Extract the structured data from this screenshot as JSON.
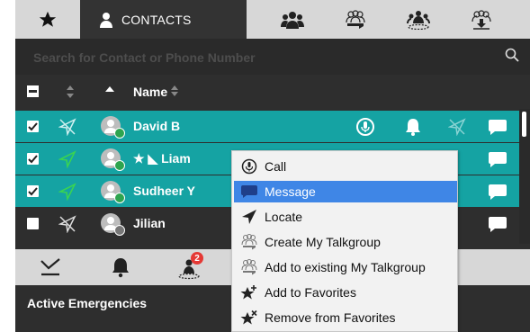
{
  "tabs": {
    "favorites_icon": "star-icon",
    "contacts_label": "CONTACTS",
    "group_icons": [
      "group-icon",
      "talkgroup-icon",
      "nearby-group-icon",
      "download-group-icon"
    ]
  },
  "search": {
    "placeholder": "Search for Contact or Phone Number"
  },
  "list_header": {
    "name_label": "Name"
  },
  "contacts": [
    {
      "name": "David B",
      "selected": true,
      "checked": true,
      "status": "online"
    },
    {
      "name": "★ ◣ Liam",
      "selected": true,
      "checked": true,
      "status": "online"
    },
    {
      "name": "Sudheer Y",
      "selected": true,
      "checked": true,
      "status": "online"
    },
    {
      "name": "Jilian",
      "selected": false,
      "checked": false,
      "status": "offline"
    }
  ],
  "bottom": {
    "emergency_badge": "2",
    "active_emergencies_title": "Active Emergencies"
  },
  "context_menu": {
    "items": [
      {
        "label": "Call",
        "icon": "call-icon",
        "highlighted": false
      },
      {
        "label": "Message",
        "icon": "message-icon",
        "highlighted": true
      },
      {
        "label": "Locate",
        "icon": "locate-icon",
        "highlighted": false
      },
      {
        "label": "Create My Talkgroup",
        "icon": "create-talkgroup-icon",
        "highlighted": false
      },
      {
        "label": "Add to existing My Talkgroup",
        "icon": "add-talkgroup-icon",
        "highlighted": false
      },
      {
        "label": "Add to Favorites",
        "icon": "add-favorite-icon",
        "highlighted": false
      },
      {
        "label": "Remove from Favorites",
        "icon": "remove-favorite-icon",
        "highlighted": false
      }
    ]
  },
  "colors": {
    "selected_row": "#15a3a3",
    "menu_highlight": "#3f86e6",
    "panel_bg": "#2e2e2e",
    "tabbar_bg": "#d7d7d7",
    "online_green": "#2ea44f",
    "badge_red": "#e53935"
  }
}
